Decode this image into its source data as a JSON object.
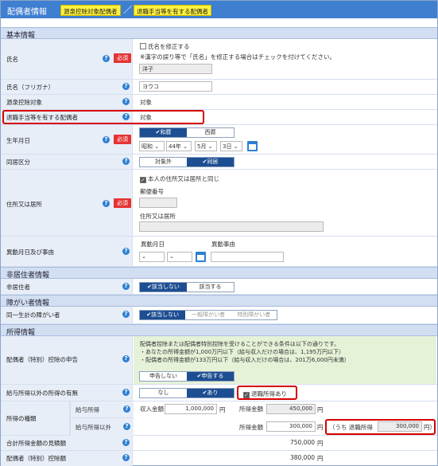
{
  "header": {
    "title": "配偶者情報",
    "tag1": "源泉控除対象配偶者",
    "tag2": "退職手当等を有する配偶者"
  },
  "q": "?",
  "req": "必須",
  "yen": "円",
  "sections": {
    "basic": "基本情報",
    "nonres": "非居住者情報",
    "disab": "障がい者情報",
    "income": "所得情報"
  },
  "name": {
    "label": "氏名",
    "cb": "氏名を修正する",
    "note": "※漢字の誤り等で「氏名」を修正する場合はチェックを付けてください。",
    "value": "洋子"
  },
  "kana": {
    "label": "氏名（フリガナ）",
    "value": "ヨウコ"
  },
  "gensen": {
    "label": "源泉控除対象",
    "value": "対象"
  },
  "taishoku": {
    "label": "退職手当等を有する配偶者",
    "value": "対象"
  },
  "birth": {
    "label": "生年月日",
    "era1": "✔和暦",
    "era2": "西暦",
    "sel1": "昭和 ⌄",
    "sel2": "44年 ⌄",
    "sel3": "5月 ⌄",
    "sel4": "3日 ⌄"
  },
  "doukyo": {
    "label": "同居区分",
    "o1": "対象外",
    "o2": "✔同居"
  },
  "address": {
    "label": "住所又は居所",
    "cb": "本人の住所又は居所と同じ",
    "zip": "郵便番号",
    "addr": "住所又は居所"
  },
  "ido": {
    "label": "異動月日及び事由",
    "date": "異動月日",
    "reason": "異動事由"
  },
  "hikyoju": {
    "label": "非居住者",
    "o1": "✔該当しない",
    "o2": "該当する"
  },
  "shogai": {
    "label": "同一生計の障がい者",
    "o1": "✔該当しない",
    "o2": "一般障がい者",
    "o3": "特別障がい者"
  },
  "shinkoku": {
    "label": "配偶者（特別）控除の申告",
    "l1": "配偶者控除または配偶者特別控除を受けることができる条件は以下の通りです。",
    "l2": "・あなたの所得金額が1,000万円以下（給与収入だけの場合は、1,195万円以下）",
    "l3": "・配偶者の所得金額が133万円以下（給与収入だけの場合は、201万6,000円未満）",
    "o1": "申告しない",
    "o2": "✔申告する"
  },
  "kyuyo_igai": {
    "label": "給与所得以外の所得の有無",
    "o1": "なし",
    "o2": "✔あり",
    "cb": "退職所得あり"
  },
  "shurui": {
    "label": "所得の種類",
    "k1": "給与所得",
    "k2": "給与所得以外",
    "shunyu": "収入金額",
    "shunyu_v": "1,000,000",
    "shotoku1": "所得金額",
    "shotoku1_v": "450,000",
    "shotoku2": "所得金額",
    "shotoku2_v": "300,000",
    "uchi": "（うち 退職所得",
    "uchi_v": "300,000",
    "uchi_end": "円）"
  },
  "gokei": {
    "label": "合計所得金額の見積額",
    "value": "750,000"
  },
  "kojo": {
    "label": "配偶者（特別）控除額",
    "value": "380,000"
  }
}
